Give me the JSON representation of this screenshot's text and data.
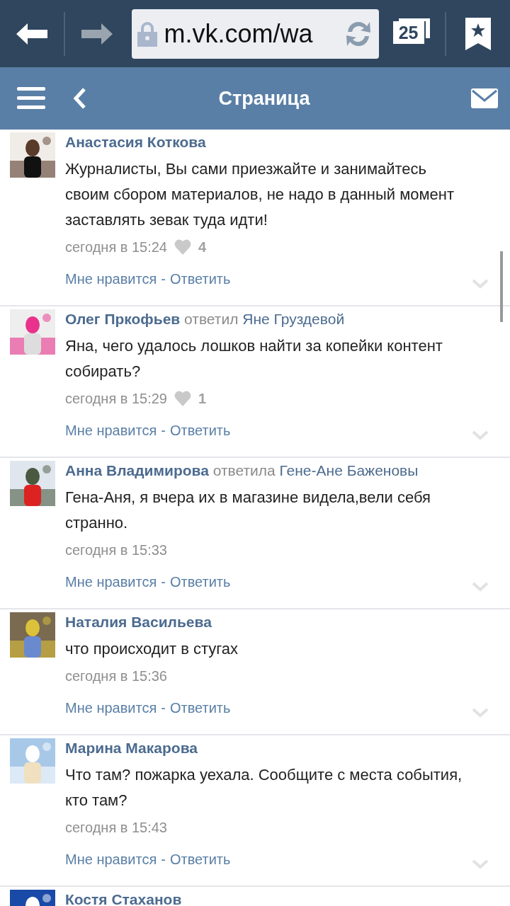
{
  "browser": {
    "url": "m.vk.com/wa",
    "tab_count": "25"
  },
  "header": {
    "title": "Страница"
  },
  "comments": [
    {
      "author": "Анастасия Коткова",
      "text": "Журналисты, Вы сами приезжайте и занимайтесь своим сбором материалов, не надо в данный момент заставлять зевак туда идти!",
      "time": "сегодня в 15:24",
      "likes": "4",
      "like_label": "Мне нравится",
      "separator": "-",
      "reply_label": "Ответить"
    },
    {
      "author": "Олег Пркофьев",
      "verb": "ответил",
      "reply_to": "Яне Груздевой",
      "text": "Яна, чего удалось лошков найти за копейки контент собирать?",
      "time": "сегодня в 15:29",
      "likes": "1",
      "like_label": "Мне нравится",
      "separator": "-",
      "reply_label": "Ответить"
    },
    {
      "author": "Анна Владимирова",
      "verb": "ответила",
      "reply_to": "Гене-Ане Баженовы",
      "text": "Гена-Аня, я вчера их в магазине видела,вели себя странно.",
      "time": "сегодня в 15:33",
      "like_label": "Мне нравится",
      "separator": "-",
      "reply_label": "Ответить"
    },
    {
      "author": "Наталия Васильева",
      "text": "что происходит в стугах",
      "time": "сегодня в 15:36",
      "like_label": "Мне нравится",
      "separator": "-",
      "reply_label": "Ответить"
    },
    {
      "author": "Марина Макарова",
      "text": "Что там? пожарка уехала. Сообщите с места события, кто там?",
      "time": "сегодня в 15:43",
      "like_label": "Мне нравится",
      "separator": "-",
      "reply_label": "Ответить"
    },
    {
      "author": "Костя Стаханов"
    }
  ]
}
